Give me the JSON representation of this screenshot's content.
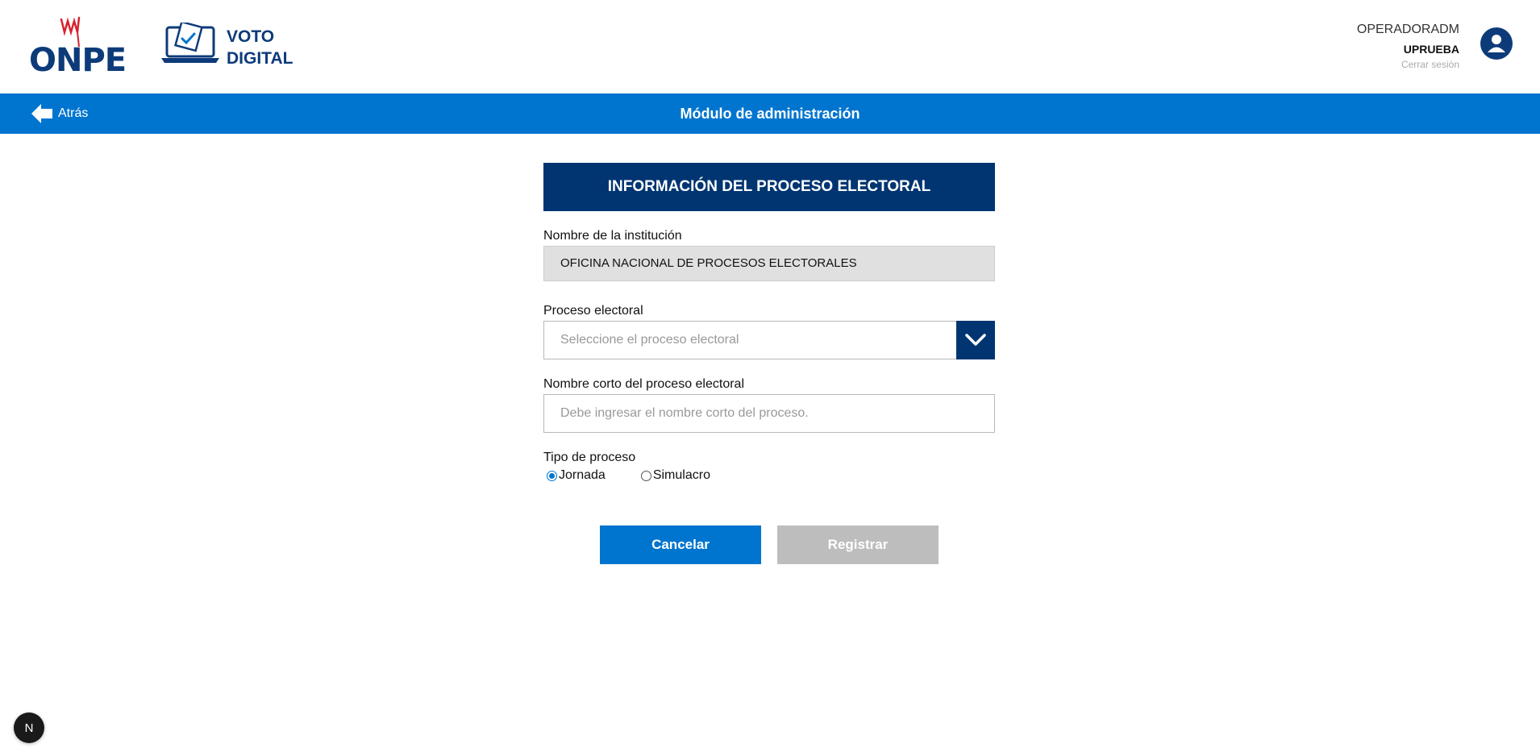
{
  "header": {
    "logo_onpe": "ONPE",
    "logo_voto_line1": "VOTO",
    "logo_voto_line2": "DIGITAL",
    "user_role": "OPERADORADM",
    "user_name": "UPRUEBA",
    "logout_label": "Cerrar sesión"
  },
  "topbar": {
    "back_label": "Atrás",
    "title": "Módulo de administración"
  },
  "form": {
    "section_title": "INFORMACIÓN DEL PROCESO ELECTORAL",
    "institution_label": "Nombre de la institución",
    "institution_value": "OFICINA NACIONAL DE PROCESOS ELECTORALES",
    "process_label": "Proceso electoral",
    "process_placeholder": "Seleccione el proceso electoral",
    "short_name_label": "Nombre corto del proceso electoral",
    "short_name_placeholder": "Debe ingresar el nombre corto del proceso.",
    "type_label": "Tipo de proceso",
    "type_options": [
      "Jornada",
      "Simulacro"
    ],
    "type_selected": "Jornada"
  },
  "actions": {
    "cancel_label": "Cancelar",
    "register_label": "Registrar"
  },
  "dev_badge": "N",
  "colors": {
    "brand_blue": "#0075cf",
    "dark_blue": "#003572",
    "disabled_gray": "#bdbdbd"
  }
}
